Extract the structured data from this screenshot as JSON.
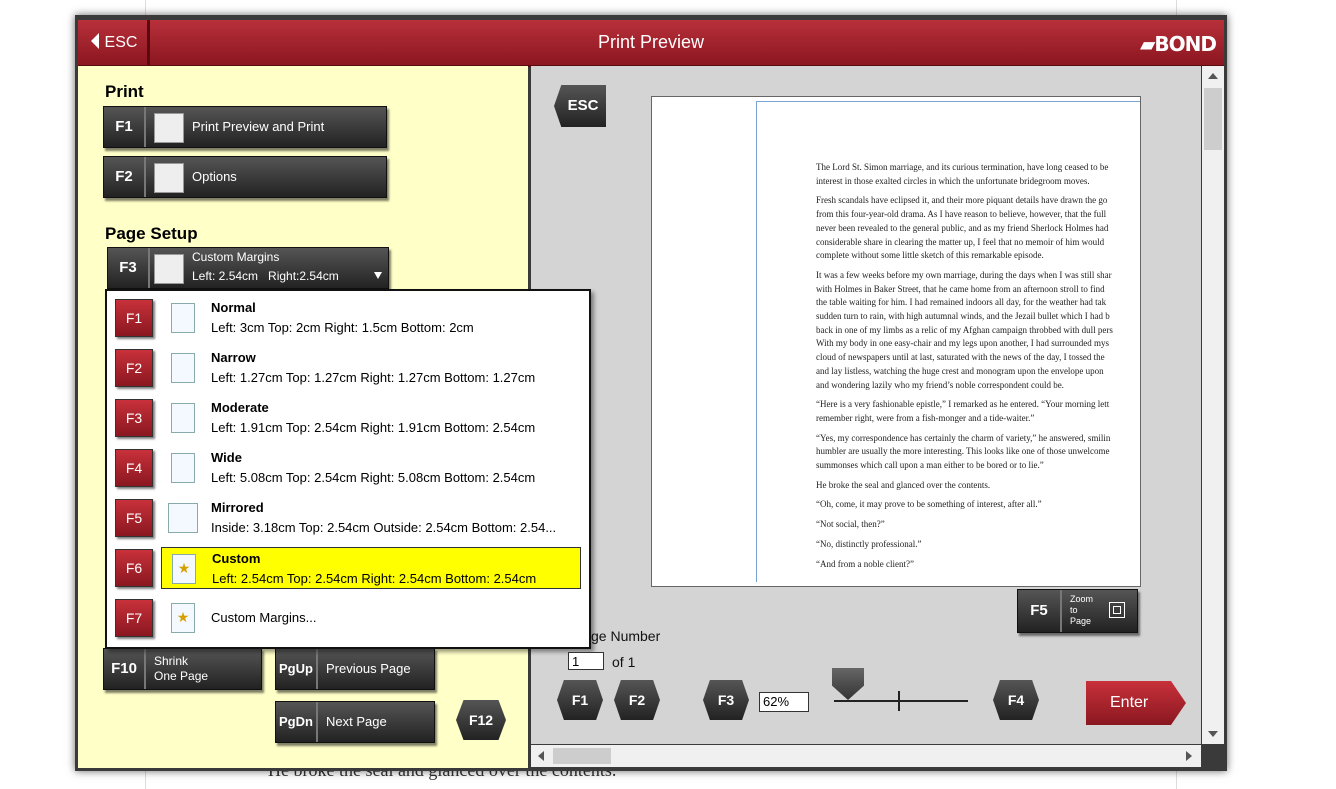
{
  "window": {
    "title": "Print Preview",
    "esc_label": "ESC",
    "logo": "BOND"
  },
  "background_text": "He broke the seal and glanced over the contents.",
  "left": {
    "print_heading": "Print",
    "print_buttons": [
      {
        "key": "F1",
        "label": "Print Preview and Print",
        "icon": "magnifier-doc-icon"
      },
      {
        "key": "F2",
        "label": "Options",
        "icon": "printer-options-icon"
      }
    ],
    "page_setup_heading": "Page Setup",
    "margins_button": {
      "key": "F3",
      "line1": "Custom Margins",
      "line2": "Left: 2.54cm   Right:2.54cm"
    },
    "shrink_button": {
      "key": "F10",
      "line1": "Shrink",
      "line2": "One Page"
    },
    "prev_button": {
      "key": "PgUp",
      "label": "Previous Page"
    },
    "next_button": {
      "key": "PgDn",
      "label": "Next Page"
    },
    "f12_label": "F12"
  },
  "margins_menu": [
    {
      "key": "F1",
      "name": "Normal",
      "desc": "Left: 3cm Top: 2cm Right: 1.5cm Bottom: 2cm",
      "selected": false
    },
    {
      "key": "F2",
      "name": "Narrow",
      "desc": "Left: 1.27cm Top: 1.27cm Right: 1.27cm Bottom: 1.27cm",
      "selected": false
    },
    {
      "key": "F3",
      "name": "Moderate",
      "desc": "Left: 1.91cm Top: 2.54cm Right: 1.91cm Bottom: 2.54cm",
      "selected": false
    },
    {
      "key": "F4",
      "name": "Wide",
      "desc": "Left: 5.08cm Top: 2.54cm Right: 5.08cm Bottom: 2.54cm",
      "selected": false
    },
    {
      "key": "F5",
      "name": "Mirrored",
      "desc": "Inside: 3.18cm Top: 2.54cm Outside: 2.54cm Bottom: 2.54...",
      "selected": false
    },
    {
      "key": "F6",
      "name": "Custom",
      "desc": "Left: 2.54cm Top: 2.54cm Right: 2.54cm Bottom: 2.54cm",
      "selected": true
    },
    {
      "key": "F7",
      "name": "",
      "desc": "Custom Margins...",
      "selected": false
    }
  ],
  "preview": {
    "esc_label": "ESC",
    "paragraphs": [
      "The Lord St. Simon marriage, and its curious termination, have long ceased to be\ninterest in those exalted circles in which the unfortunate bridegroom moves.",
      "Fresh scandals have eclipsed it, and their more piquant details have drawn the go\nfrom this four-year-old drama. As I have reason to believe, however, that the full\nnever been revealed to the general public, and as my friend Sherlock Holmes had\nconsiderable share in clearing the matter up, I feel that no memoir of him would\ncomplete without some little sketch of this remarkable episode.",
      "It was a few weeks before my own marriage, during the days when I was still shar\nwith Holmes in Baker Street, that he came home from an afternoon stroll to find\nthe table waiting for him. I had remained indoors all day, for the weather had tak\nsudden turn to rain, with high autumnal winds, and the Jezail bullet which I had b\nback in one of my limbs as a relic of my Afghan campaign throbbed with dull pers\nWith my body in one easy-chair and my legs upon another, I had surrounded mys\ncloud of newspapers until at last, saturated with the news of the day, I tossed the\nand lay listless, watching the huge crest and monogram upon the envelope upon\nand wondering lazily who my friend’s noble correspondent could be.",
      "“Here is a very fashionable epistle,” I remarked as he entered. “Your morning lett\nremember right, were from a fish-monger and a tide-waiter.”",
      "“Yes, my correspondence has certainly the charm of variety,” he answered, smilin\nhumbler are usually the more interesting. This looks like one of those unwelcome\nsummonses which call upon a man either to be bored or to lie.”",
      "He broke the seal and glanced over the contents.",
      "“Oh, come, it may prove to be something of interest, after all.”",
      "“Not social, then?”",
      "“No, distinctly professional.”",
      "“And from a noble client?”"
    ],
    "zoom_page": {
      "key": "F5",
      "label": "Zoom\nto\nPage"
    },
    "page_number_label": "ge Number",
    "page_value": "1",
    "page_total": "of 1",
    "buttons": {
      "f1": "F1",
      "f2": "F2",
      "f3": "F3",
      "f4": "F4"
    },
    "zoom_value": "62%",
    "enter_label": "Enter"
  },
  "colors": {
    "accent_red": "#a8252e",
    "left_pane": "#ffffc8",
    "selected": "#ffff00"
  }
}
